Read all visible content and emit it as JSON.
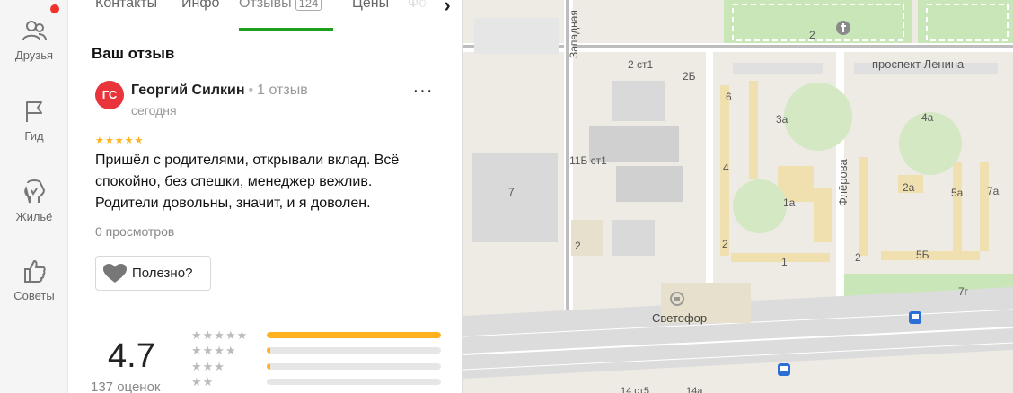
{
  "sidebar": {
    "items": [
      {
        "label": "Друзья",
        "icon": "friends-icon"
      },
      {
        "label": "Гид",
        "icon": "flag-icon"
      },
      {
        "label": "Жильё",
        "icon": "house-icon"
      },
      {
        "label": "Советы",
        "icon": "thumbs-up-icon"
      }
    ],
    "has_notification": true
  },
  "tabs": {
    "items": [
      "Контакты",
      "Инфо",
      "Отзывы",
      "Цены",
      "Фо"
    ],
    "active": "Отзывы",
    "reviews_count": "124"
  },
  "review": {
    "section_title": "Ваш отзыв",
    "avatar_initials": "ГС",
    "author": "Георгий Силкин",
    "author_reviews": "1 отзыв",
    "date": "сегодня",
    "rating": 5,
    "stars": "★★★★★",
    "text": "Пришёл с родителями, открывали вклад. Всё спокойно, без спешки, менеджер вежлив. Родители довольны, значит, и я доволен.",
    "views": "0 просмотров",
    "useful_label": "Полезно?"
  },
  "summary": {
    "rating": "4.7",
    "count": "137 оценок",
    "distribution": [
      {
        "stars": "★★★★★",
        "share": 1.0
      },
      {
        "stars": "★★★★",
        "share": 0.02
      },
      {
        "stars": "★★★",
        "share": 0.02
      },
      {
        "stars": "★★",
        "share": 0.0
      }
    ]
  },
  "map": {
    "streets": [
      "Западная",
      "проспект Ленина",
      "Флёрова"
    ],
    "poi": "Светофор",
    "building_numbers": [
      "2 ст1",
      "2Б",
      "6",
      "3а",
      "4а",
      "11Б ст1",
      "4",
      "2а",
      "5а",
      "7а",
      "7",
      "1а",
      "2",
      "2",
      "5Б",
      "2",
      "1",
      "2",
      "7г",
      "14 ст5",
      "14а"
    ]
  },
  "colors": {
    "accent": "#1ea01e",
    "star": "#ffb21e",
    "avatar": "#e8343a",
    "notification": "#f0332a"
  }
}
